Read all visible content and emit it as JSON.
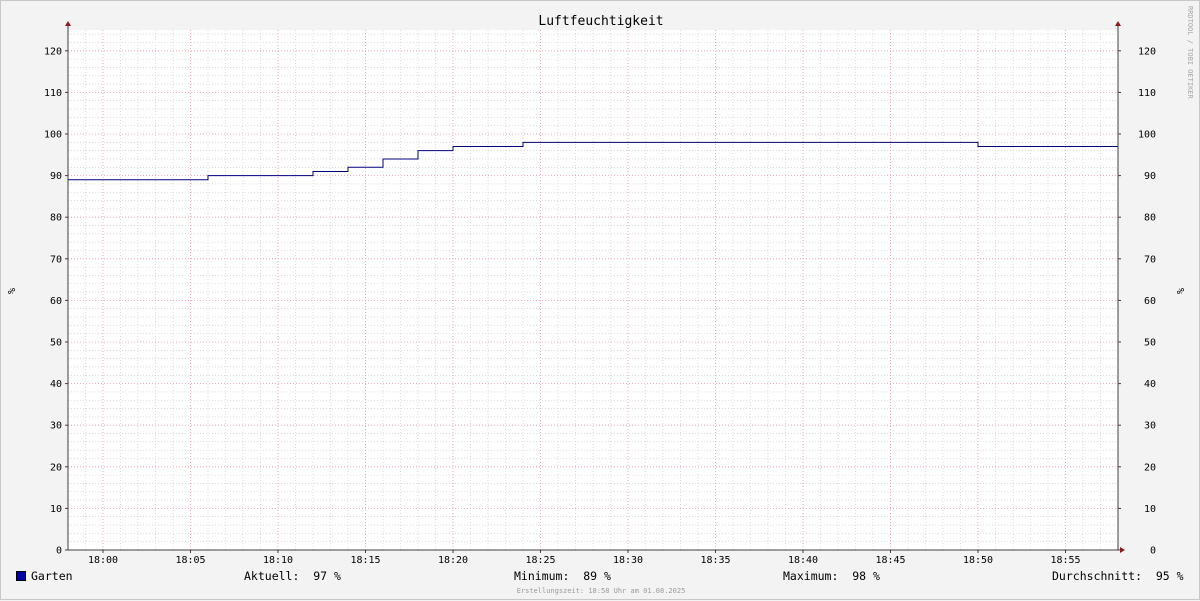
{
  "chart_data": {
    "type": "line",
    "title": "Luftfeuchtigkeit",
    "ylabel_left": "%",
    "ylabel_right": "%",
    "ylim": [
      0,
      125
    ],
    "yticks": [
      0,
      10,
      20,
      30,
      40,
      50,
      60,
      70,
      80,
      90,
      100,
      110,
      120
    ],
    "xlim": [
      "17:58",
      "18:58"
    ],
    "xticks": [
      "18:00",
      "18:05",
      "18:10",
      "18:15",
      "18:20",
      "18:25",
      "18:30",
      "18:35",
      "18:40",
      "18:45",
      "18:50",
      "18:55"
    ],
    "grid": true,
    "step": true,
    "series": [
      {
        "name": "Garten",
        "color": "#00007a",
        "points": [
          [
            "17:58",
            89
          ],
          [
            "18:06",
            90
          ],
          [
            "18:12",
            91
          ],
          [
            "18:14",
            92
          ],
          [
            "18:16",
            94
          ],
          [
            "18:18",
            96
          ],
          [
            "18:20",
            97
          ],
          [
            "18:24",
            98
          ],
          [
            "18:50",
            97
          ],
          [
            "18:58",
            97
          ]
        ]
      }
    ],
    "legend": {
      "series_name": "Garten",
      "swatch_color": "#0000a8",
      "current": "Aktuell:  97 %",
      "minimum": "Minimum:  89 %",
      "maximum": "Maximum:  98 %",
      "average": "Durchschnitt:  95 %"
    },
    "footer": "Erstellungszeit: 18:58 Uhr am 01.08.2025",
    "watermark": "RRDTOOL / TOBI OETIKER",
    "colors": {
      "background": "#f3f3f3",
      "plot_background": "#ffffff",
      "major_grid": "#e89aa8",
      "minor_grid": "#c8c8c8",
      "axis": "#404040",
      "arrow": "#8b1a1a"
    }
  }
}
